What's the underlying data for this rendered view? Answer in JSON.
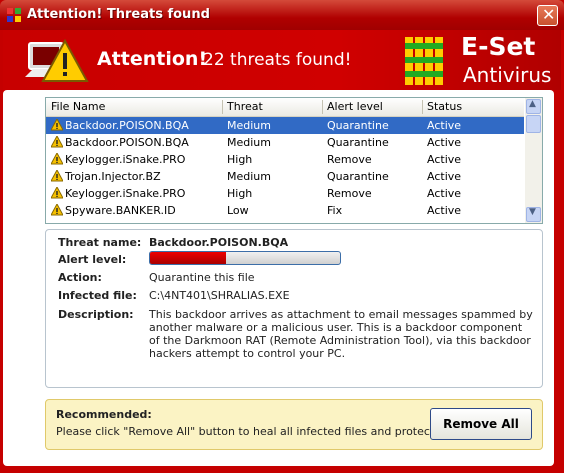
{
  "window": {
    "title": "Attention! Threats found"
  },
  "header": {
    "attention": "Attention!",
    "threats_found": "22 threats found!",
    "brand_name": "E-Set",
    "brand_sub": "Antivirus"
  },
  "table": {
    "columns": [
      "File Name",
      "Threat",
      "Alert level",
      "Status"
    ],
    "rows": [
      {
        "file": "Backdoor.POISON.BQA",
        "threat": "Medium",
        "alert": "Quarantine",
        "status": "Active",
        "selected": true
      },
      {
        "file": "Backdoor.POISON.BQA",
        "threat": "Medium",
        "alert": "Quarantine",
        "status": "Active"
      },
      {
        "file": "Keylogger.iSnake.PRO",
        "threat": "High",
        "alert": "Remove",
        "status": "Active"
      },
      {
        "file": "Trojan.Injector.BZ",
        "threat": "Medium",
        "alert": "Quarantine",
        "status": "Active"
      },
      {
        "file": "Keylogger.iSnake.PRO",
        "threat": "High",
        "alert": "Remove",
        "status": "Active"
      },
      {
        "file": "Spyware.BANKER.ID",
        "threat": "Low",
        "alert": "Fix",
        "status": "Active"
      }
    ]
  },
  "details": {
    "threat_name_label": "Threat name:",
    "threat_name": "Backdoor.POISON.BQA",
    "alert_level_label": "Alert level:",
    "alert_level_fraction": 0.4,
    "action_label": "Action:",
    "action": "Quarantine this file",
    "infected_label": "Infected file:",
    "infected_file": "C:\\4NT401\\SHRALIAS.EXE",
    "description_label": "Description:",
    "description": "This backdoor arrives as attachment to email messages spammed by another malware or a malicious user. This is a backdoor component of the Darkmoon RAT (Remote Administration Tool), via this backdoor hackers attempt to control your PC."
  },
  "recommend": {
    "title": "Recommended:",
    "text": "Please click \"Remove All\" button to heal all infected files and protect your PC",
    "button": "Remove All"
  },
  "colors": {
    "accent": "#c50000",
    "selection": "#316ac5"
  }
}
